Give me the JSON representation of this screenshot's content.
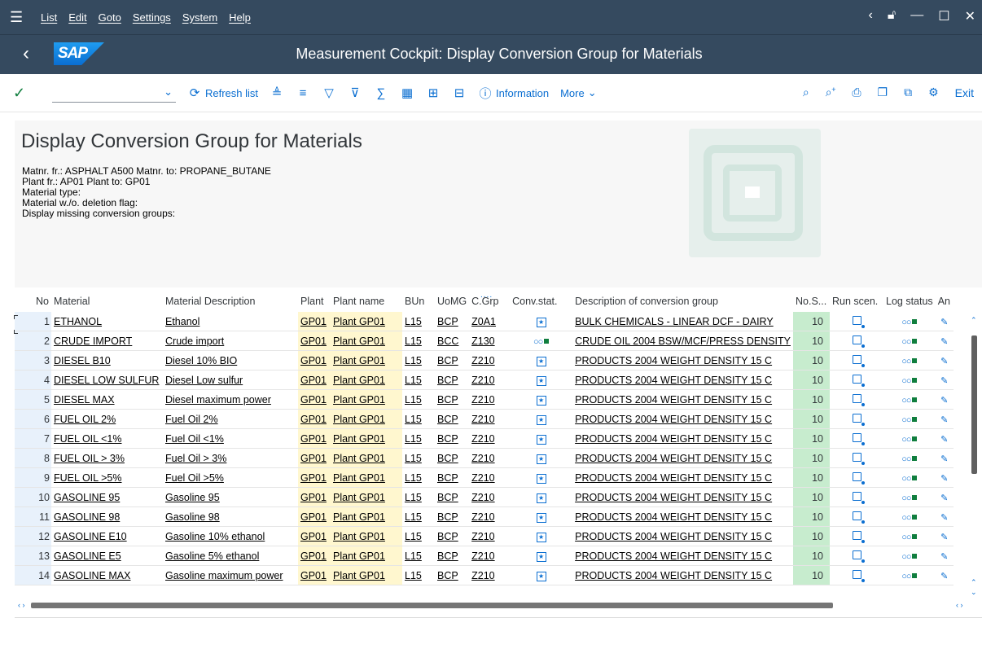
{
  "menubar": {
    "items": [
      "List",
      "Edit",
      "Goto",
      "Settings",
      "System",
      "Help"
    ]
  },
  "title": "Measurement Cockpit: Display Conversion Group for Materials",
  "toolbar": {
    "refresh_label": "Refresh list",
    "information_label": "Information",
    "more_label": "More",
    "exit_label": "Exit"
  },
  "header": {
    "page_title": "Display Conversion Group for Materials",
    "lines": [
      "Matnr. fr.: ASPHALT A500 Matnr. to: PROPANE_BUTANE",
      "Plant fr.: AP01 Plant to: GP01",
      "Material type:",
      "Material w./o. deletion flag:",
      "Display missing conversion groups:"
    ]
  },
  "table": {
    "columns": [
      "No",
      "Material",
      "Material Description",
      "Plant",
      "Plant name",
      "BUn",
      "UoMG",
      "C.Grp",
      "Conv.stat.",
      "Description of conversion group",
      "No.S...",
      "Run scen.",
      "Log status",
      "An"
    ],
    "rows": [
      {
        "no": "1",
        "material": "ETHANOL",
        "desc": "Ethanol",
        "plant": "GP01",
        "plant_name": "Plant GP01",
        "bun": "L15",
        "uomg": "BCP",
        "cgrp": "Z0A1",
        "conv": "icon",
        "group_desc": "BULK CHEMICALS - LINEAR DCF - DAIRY",
        "nos": "10"
      },
      {
        "no": "2",
        "material": "CRUDE IMPORT",
        "desc": "Crude import",
        "plant": "GP01",
        "plant_name": "Plant GP01",
        "bun": "L15",
        "uomg": "BCC",
        "cgrp": "Z130",
        "conv": "status",
        "group_desc": "CRUDE OIL 2004 BSW/MCF/PRESS DENSITY",
        "nos": "10"
      },
      {
        "no": "3",
        "material": "DIESEL B10",
        "desc": "Diesel 10% BIO",
        "plant": "GP01",
        "plant_name": "Plant GP01",
        "bun": "L15",
        "uomg": "BCP",
        "cgrp": "Z210",
        "conv": "icon",
        "group_desc": "PRODUCTS 2004 WEIGHT DENSITY 15 C",
        "nos": "10"
      },
      {
        "no": "4",
        "material": "DIESEL LOW SULFUR",
        "desc": "Diesel Low sulfur",
        "plant": "GP01",
        "plant_name": "Plant GP01",
        "bun": "L15",
        "uomg": "BCP",
        "cgrp": "Z210",
        "conv": "icon",
        "group_desc": "PRODUCTS 2004 WEIGHT DENSITY 15 C",
        "nos": "10"
      },
      {
        "no": "5",
        "material": "DIESEL MAX",
        "desc": "Diesel maximum power",
        "plant": "GP01",
        "plant_name": "Plant GP01",
        "bun": "L15",
        "uomg": "BCP",
        "cgrp": "Z210",
        "conv": "icon",
        "group_desc": "PRODUCTS 2004 WEIGHT DENSITY 15 C",
        "nos": "10"
      },
      {
        "no": "6",
        "material": "FUEL OIL 2%",
        "desc": "Fuel Oil 2%",
        "plant": "GP01",
        "plant_name": "Plant GP01",
        "bun": "L15",
        "uomg": "BCP",
        "cgrp": "Z210",
        "conv": "icon",
        "group_desc": "PRODUCTS 2004 WEIGHT DENSITY 15 C",
        "nos": "10"
      },
      {
        "no": "7",
        "material": "FUEL OIL <1%",
        "desc": "Fuel Oil <1%",
        "plant": "GP01",
        "plant_name": "Plant GP01",
        "bun": "L15",
        "uomg": "BCP",
        "cgrp": "Z210",
        "conv": "icon",
        "group_desc": "PRODUCTS 2004 WEIGHT DENSITY 15 C",
        "nos": "10"
      },
      {
        "no": "8",
        "material": "FUEL OIL > 3%",
        "desc": "Fuel Oil > 3%",
        "plant": "GP01",
        "plant_name": "Plant GP01",
        "bun": "L15",
        "uomg": "BCP",
        "cgrp": "Z210",
        "conv": "icon",
        "group_desc": "PRODUCTS 2004 WEIGHT DENSITY 15 C",
        "nos": "10"
      },
      {
        "no": "9",
        "material": "FUEL OIL >5%",
        "desc": "Fuel Oil >5%",
        "plant": "GP01",
        "plant_name": "Plant GP01",
        "bun": "L15",
        "uomg": "BCP",
        "cgrp": "Z210",
        "conv": "icon",
        "group_desc": "PRODUCTS 2004 WEIGHT DENSITY 15 C",
        "nos": "10"
      },
      {
        "no": "10",
        "material": "GASOLINE 95",
        "desc": "Gasoline 95",
        "plant": "GP01",
        "plant_name": "Plant GP01",
        "bun": "L15",
        "uomg": "BCP",
        "cgrp": "Z210",
        "conv": "icon",
        "group_desc": "PRODUCTS 2004 WEIGHT DENSITY 15 C",
        "nos": "10"
      },
      {
        "no": "11",
        "material": "GASOLINE 98",
        "desc": "Gasoline 98",
        "plant": "GP01",
        "plant_name": "Plant GP01",
        "bun": "L15",
        "uomg": "BCP",
        "cgrp": "Z210",
        "conv": "icon",
        "group_desc": "PRODUCTS 2004 WEIGHT DENSITY 15 C",
        "nos": "10"
      },
      {
        "no": "12",
        "material": "GASOLINE E10",
        "desc": "Gasoline 10% ethanol",
        "plant": "GP01",
        "plant_name": "Plant GP01",
        "bun": "L15",
        "uomg": "BCP",
        "cgrp": "Z210",
        "conv": "icon",
        "group_desc": "PRODUCTS 2004 WEIGHT DENSITY 15 C",
        "nos": "10"
      },
      {
        "no": "13",
        "material": "GASOLINE E5",
        "desc": "Gasoline 5% ethanol",
        "plant": "GP01",
        "plant_name": "Plant GP01",
        "bun": "L15",
        "uomg": "BCP",
        "cgrp": "Z210",
        "conv": "icon",
        "group_desc": "PRODUCTS 2004 WEIGHT DENSITY 15 C",
        "nos": "10"
      },
      {
        "no": "14",
        "material": "GASOLINE MAX",
        "desc": "Gasoline maximum power",
        "plant": "GP01",
        "plant_name": "Plant GP01",
        "bun": "L15",
        "uomg": "BCP",
        "cgrp": "Z210",
        "conv": "icon",
        "group_desc": "PRODUCTS 2004 WEIGHT DENSITY 15 C",
        "nos": "10"
      }
    ]
  },
  "colors": {
    "shell": "#354a5f",
    "accent": "#0a6ed1",
    "key_column": "#e8f1fb",
    "plant_column": "#fff7cf",
    "count_column": "#c7ecce"
  }
}
